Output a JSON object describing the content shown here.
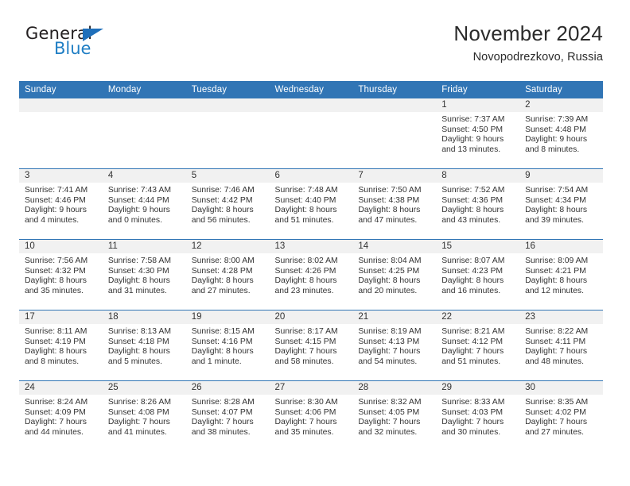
{
  "brand": {
    "word_one": "General",
    "word_two": "Blue",
    "triangle_color": "#1f6fba",
    "blue_color": "#1f7ec4"
  },
  "header": {
    "title": "November 2024",
    "subtitle": "Novopodrezkovo, Russia"
  },
  "theme": {
    "header_blue": "#3175b5",
    "daynum_gray": "#f1f1f1",
    "text": "#333333"
  },
  "weekdays": [
    "Sunday",
    "Monday",
    "Tuesday",
    "Wednesday",
    "Thursday",
    "Friday",
    "Saturday"
  ],
  "weeks": [
    [
      {
        "day": "",
        "empty": true
      },
      {
        "day": "",
        "empty": true
      },
      {
        "day": "",
        "empty": true
      },
      {
        "day": "",
        "empty": true
      },
      {
        "day": "",
        "empty": true
      },
      {
        "day": "1",
        "sunrise": "Sunrise: 7:37 AM",
        "sunset": "Sunset: 4:50 PM",
        "daylight_1": "Daylight: 9 hours",
        "daylight_2": "and 13 minutes."
      },
      {
        "day": "2",
        "sunrise": "Sunrise: 7:39 AM",
        "sunset": "Sunset: 4:48 PM",
        "daylight_1": "Daylight: 9 hours",
        "daylight_2": "and 8 minutes."
      }
    ],
    [
      {
        "day": "3",
        "sunrise": "Sunrise: 7:41 AM",
        "sunset": "Sunset: 4:46 PM",
        "daylight_1": "Daylight: 9 hours",
        "daylight_2": "and 4 minutes."
      },
      {
        "day": "4",
        "sunrise": "Sunrise: 7:43 AM",
        "sunset": "Sunset: 4:44 PM",
        "daylight_1": "Daylight: 9 hours",
        "daylight_2": "and 0 minutes."
      },
      {
        "day": "5",
        "sunrise": "Sunrise: 7:46 AM",
        "sunset": "Sunset: 4:42 PM",
        "daylight_1": "Daylight: 8 hours",
        "daylight_2": "and 56 minutes."
      },
      {
        "day": "6",
        "sunrise": "Sunrise: 7:48 AM",
        "sunset": "Sunset: 4:40 PM",
        "daylight_1": "Daylight: 8 hours",
        "daylight_2": "and 51 minutes."
      },
      {
        "day": "7",
        "sunrise": "Sunrise: 7:50 AM",
        "sunset": "Sunset: 4:38 PM",
        "daylight_1": "Daylight: 8 hours",
        "daylight_2": "and 47 minutes."
      },
      {
        "day": "8",
        "sunrise": "Sunrise: 7:52 AM",
        "sunset": "Sunset: 4:36 PM",
        "daylight_1": "Daylight: 8 hours",
        "daylight_2": "and 43 minutes."
      },
      {
        "day": "9",
        "sunrise": "Sunrise: 7:54 AM",
        "sunset": "Sunset: 4:34 PM",
        "daylight_1": "Daylight: 8 hours",
        "daylight_2": "and 39 minutes."
      }
    ],
    [
      {
        "day": "10",
        "sunrise": "Sunrise: 7:56 AM",
        "sunset": "Sunset: 4:32 PM",
        "daylight_1": "Daylight: 8 hours",
        "daylight_2": "and 35 minutes."
      },
      {
        "day": "11",
        "sunrise": "Sunrise: 7:58 AM",
        "sunset": "Sunset: 4:30 PM",
        "daylight_1": "Daylight: 8 hours",
        "daylight_2": "and 31 minutes."
      },
      {
        "day": "12",
        "sunrise": "Sunrise: 8:00 AM",
        "sunset": "Sunset: 4:28 PM",
        "daylight_1": "Daylight: 8 hours",
        "daylight_2": "and 27 minutes."
      },
      {
        "day": "13",
        "sunrise": "Sunrise: 8:02 AM",
        "sunset": "Sunset: 4:26 PM",
        "daylight_1": "Daylight: 8 hours",
        "daylight_2": "and 23 minutes."
      },
      {
        "day": "14",
        "sunrise": "Sunrise: 8:04 AM",
        "sunset": "Sunset: 4:25 PM",
        "daylight_1": "Daylight: 8 hours",
        "daylight_2": "and 20 minutes."
      },
      {
        "day": "15",
        "sunrise": "Sunrise: 8:07 AM",
        "sunset": "Sunset: 4:23 PM",
        "daylight_1": "Daylight: 8 hours",
        "daylight_2": "and 16 minutes."
      },
      {
        "day": "16",
        "sunrise": "Sunrise: 8:09 AM",
        "sunset": "Sunset: 4:21 PM",
        "daylight_1": "Daylight: 8 hours",
        "daylight_2": "and 12 minutes."
      }
    ],
    [
      {
        "day": "17",
        "sunrise": "Sunrise: 8:11 AM",
        "sunset": "Sunset: 4:19 PM",
        "daylight_1": "Daylight: 8 hours",
        "daylight_2": "and 8 minutes."
      },
      {
        "day": "18",
        "sunrise": "Sunrise: 8:13 AM",
        "sunset": "Sunset: 4:18 PM",
        "daylight_1": "Daylight: 8 hours",
        "daylight_2": "and 5 minutes."
      },
      {
        "day": "19",
        "sunrise": "Sunrise: 8:15 AM",
        "sunset": "Sunset: 4:16 PM",
        "daylight_1": "Daylight: 8 hours",
        "daylight_2": "and 1 minute."
      },
      {
        "day": "20",
        "sunrise": "Sunrise: 8:17 AM",
        "sunset": "Sunset: 4:15 PM",
        "daylight_1": "Daylight: 7 hours",
        "daylight_2": "and 58 minutes."
      },
      {
        "day": "21",
        "sunrise": "Sunrise: 8:19 AM",
        "sunset": "Sunset: 4:13 PM",
        "daylight_1": "Daylight: 7 hours",
        "daylight_2": "and 54 minutes."
      },
      {
        "day": "22",
        "sunrise": "Sunrise: 8:21 AM",
        "sunset": "Sunset: 4:12 PM",
        "daylight_1": "Daylight: 7 hours",
        "daylight_2": "and 51 minutes."
      },
      {
        "day": "23",
        "sunrise": "Sunrise: 8:22 AM",
        "sunset": "Sunset: 4:11 PM",
        "daylight_1": "Daylight: 7 hours",
        "daylight_2": "and 48 minutes."
      }
    ],
    [
      {
        "day": "24",
        "sunrise": "Sunrise: 8:24 AM",
        "sunset": "Sunset: 4:09 PM",
        "daylight_1": "Daylight: 7 hours",
        "daylight_2": "and 44 minutes."
      },
      {
        "day": "25",
        "sunrise": "Sunrise: 8:26 AM",
        "sunset": "Sunset: 4:08 PM",
        "daylight_1": "Daylight: 7 hours",
        "daylight_2": "and 41 minutes."
      },
      {
        "day": "26",
        "sunrise": "Sunrise: 8:28 AM",
        "sunset": "Sunset: 4:07 PM",
        "daylight_1": "Daylight: 7 hours",
        "daylight_2": "and 38 minutes."
      },
      {
        "day": "27",
        "sunrise": "Sunrise: 8:30 AM",
        "sunset": "Sunset: 4:06 PM",
        "daylight_1": "Daylight: 7 hours",
        "daylight_2": "and 35 minutes."
      },
      {
        "day": "28",
        "sunrise": "Sunrise: 8:32 AM",
        "sunset": "Sunset: 4:05 PM",
        "daylight_1": "Daylight: 7 hours",
        "daylight_2": "and 32 minutes."
      },
      {
        "day": "29",
        "sunrise": "Sunrise: 8:33 AM",
        "sunset": "Sunset: 4:03 PM",
        "daylight_1": "Daylight: 7 hours",
        "daylight_2": "and 30 minutes."
      },
      {
        "day": "30",
        "sunrise": "Sunrise: 8:35 AM",
        "sunset": "Sunset: 4:02 PM",
        "daylight_1": "Daylight: 7 hours",
        "daylight_2": "and 27 minutes."
      }
    ]
  ]
}
